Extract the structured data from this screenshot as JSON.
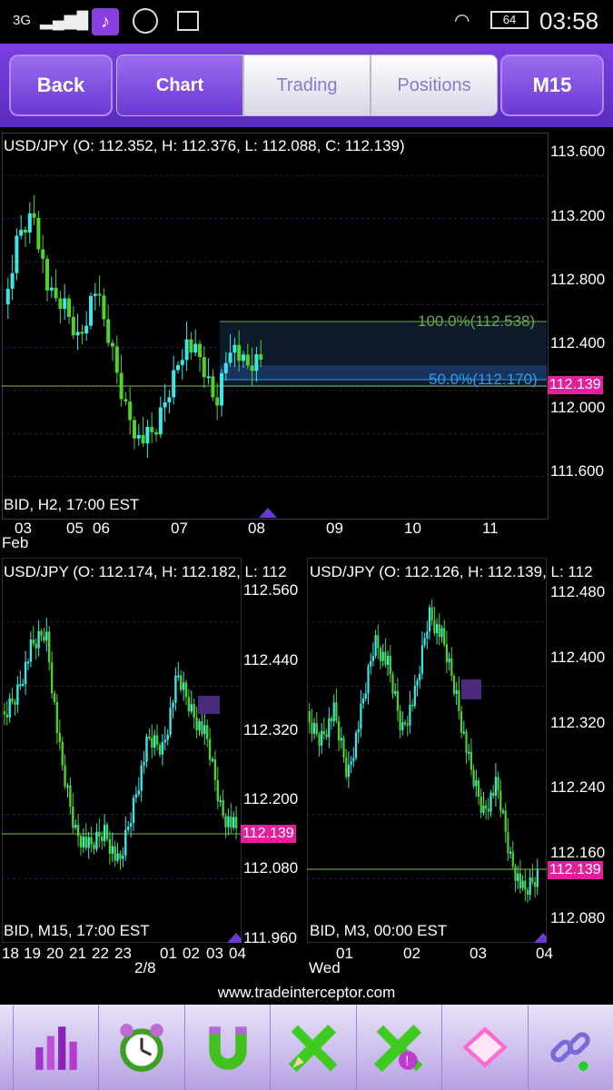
{
  "status": {
    "network": "3G",
    "battery": "64",
    "time": "03:58"
  },
  "toolbar": {
    "back": "Back",
    "tabs": [
      "Chart",
      "Trading",
      "Positions"
    ],
    "timeframe": "M15"
  },
  "main_chart": {
    "title": "USD/JPY (O: 112.352, H: 112.376, L: 112.088, C: 112.139)",
    "bid_label": "BID, H2, 17:00 EST",
    "price_axis": [
      "113.600",
      "113.200",
      "112.800",
      "112.400",
      "112.000",
      "111.600"
    ],
    "current_price": "112.139",
    "fib_100": "100.0%(112.538)",
    "fib_50": "50.0%(112.170)",
    "date_axis": [
      "03",
      "05",
      "06",
      "07",
      "08",
      "09",
      "10",
      "11"
    ],
    "month_label": "Feb"
  },
  "left_chart": {
    "title": "USD/JPY (O: 112.174, H: 112.182, L: 112",
    "bid_label": "BID, M15, 17:00 EST",
    "price_axis": [
      "112.560",
      "112.440",
      "112.320",
      "112.200",
      "112.080",
      "111.960"
    ],
    "current_price": "112.139",
    "time_axis": [
      "18",
      "19",
      "20",
      "21",
      "22",
      "23",
      "01",
      "02",
      "03",
      "04"
    ],
    "date_label": "2/8"
  },
  "right_chart": {
    "title": "USD/JPY (O: 112.126, H: 112.139, L: 112",
    "bid_label": "BID, M3, 00:00 EST",
    "price_axis": [
      "112.480",
      "112.400",
      "112.320",
      "112.240",
      "112.160",
      "112.080"
    ],
    "current_price": "112.139",
    "time_axis": [
      "01",
      "02",
      "03",
      "04"
    ],
    "day_label": "Wed"
  },
  "website": "www.tradeinterceptor.com",
  "colors": {
    "bull": "#3ee6e6",
    "bear": "#4fd22a",
    "price_tag": "#e61e9e",
    "fib_100": "#6aa84f",
    "fib_50": "#2e9be6",
    "accent": "#6a38d2"
  },
  "bottom_tools": [
    "chart-bars-icon",
    "alarm-clock-icon",
    "magnet-icon",
    "pencil-cross-icon",
    "pencil-alert-icon",
    "folder-icon",
    "link-icon"
  ]
}
